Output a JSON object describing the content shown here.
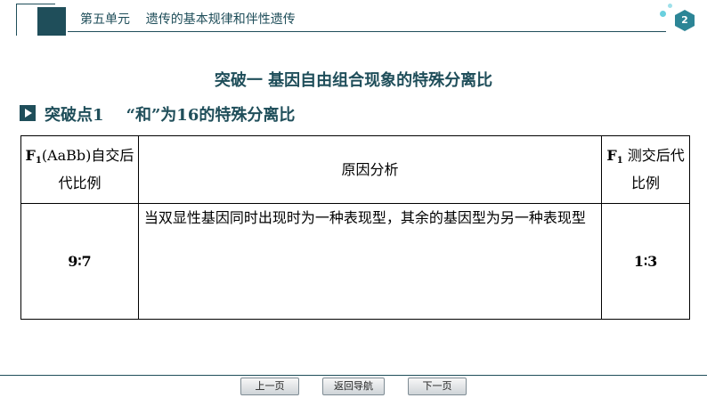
{
  "header": {
    "unit_title": "第五单元    遗传的基本规律和伴性遗传",
    "page_number": "2"
  },
  "main_heading": "突破一    基因自由组合现象的特殊分离比",
  "sub_heading": "突破点1    “和”为16的特殊分离比",
  "table": {
    "headers": {
      "col1_prefix": "F",
      "col1_sub": "1",
      "col1_rest": "(AaBb)自交后代比例",
      "col2": "原因分析",
      "col3_prefix": "F",
      "col3_sub": "1",
      "col3_rest": " 测交后代比例"
    },
    "rows": [
      {
        "ratio": "9∶7",
        "reason": "当双显性基因同时出现时为一种表现型，其余的基因型为另一种表现型",
        "test_ratio": "1∶3"
      }
    ]
  },
  "footer": {
    "prev": "上一页",
    "nav": "返回导航",
    "next": "下一页"
  },
  "colors": {
    "accent": "#1f4e5a",
    "hex_fill": "#2c8596"
  }
}
